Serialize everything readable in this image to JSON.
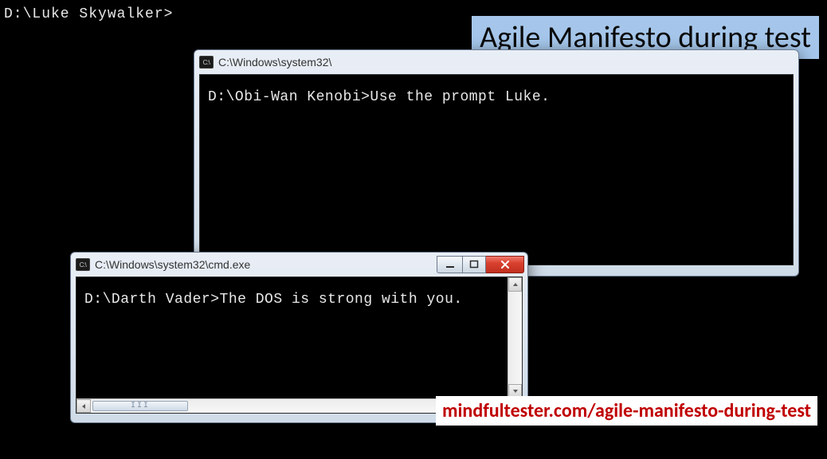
{
  "background": {
    "prompt": "D:\\Luke Skywalker>"
  },
  "overlays": {
    "title": "Agile Manifesto during test",
    "url": "mindfultester.com/agile-manifesto-during-test"
  },
  "windows": {
    "obi": {
      "icon_label": "C:\\",
      "title_truncated": "C:\\Windows\\system32\\",
      "prompt_line": "D:\\Obi-Wan Kenobi>Use the prompt Luke."
    },
    "vader": {
      "icon_label": "C:\\",
      "title": "C:\\Windows\\system32\\cmd.exe",
      "prompt_line": "D:\\Darth Vader>The DOS is strong with you."
    }
  }
}
